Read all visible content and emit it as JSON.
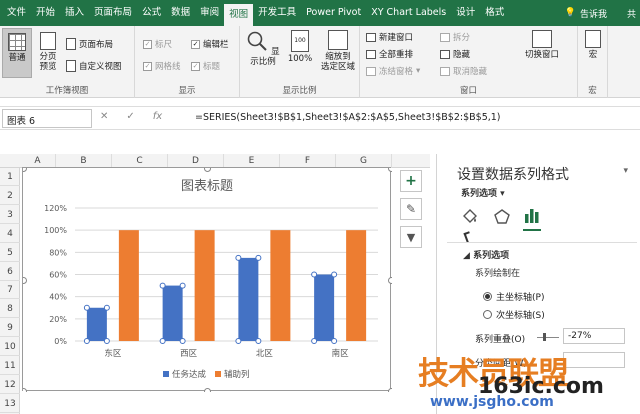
{
  "tabs": [
    "文件",
    "开始",
    "插入",
    "页面布局",
    "公式",
    "数据",
    "审阅",
    "视图",
    "开发工具",
    "Power Pivot",
    "XY Chart Labels",
    "设计",
    "格式"
  ],
  "active_tab": "视图",
  "tell_me": "告诉我",
  "share": "共",
  "ribbon": {
    "workbook_views": {
      "normal": "普通",
      "page_break": "分页\n预览",
      "page_layout": "页面布局",
      "custom_views": "自定义视图",
      "label": "工作簿视图"
    },
    "show": {
      "ruler": "标尺",
      "gridlines": "网格线",
      "formula_bar": "编辑栏",
      "headings": "标题",
      "label": "显示"
    },
    "zoom": {
      "zoom": "显示比例",
      "hundred": "100%",
      "zoom_selection": "缩放到\n选定区域",
      "label": "显示比例"
    },
    "window": {
      "new_window": "新建窗口",
      "arrange_all": "全部重排",
      "freeze": "冻结窗格",
      "split": "拆分",
      "hide": "隐藏",
      "unhide": "取消隐藏",
      "switch": "切换窗口",
      "label": "窗口"
    },
    "macros": {
      "macros": "宏",
      "label": "宏"
    }
  },
  "formula_bar": {
    "name_box": "图表 6",
    "cancel": "✕",
    "enter": "✓",
    "fx": "fx",
    "formula": "=SERIES(Sheet3!$B$1,Sheet3!$A$2:$A$5,Sheet3!$B$2:$B$5,1)"
  },
  "columns": [
    "A",
    "B",
    "C",
    "D",
    "E",
    "F",
    "G"
  ],
  "rows": [
    "1",
    "2",
    "3",
    "4",
    "5",
    "6",
    "7",
    "8",
    "9",
    "10",
    "11",
    "12",
    "13"
  ],
  "chart_data": {
    "type": "bar",
    "title": "图表标题",
    "categories": [
      "东区",
      "西区",
      "北区",
      "南区"
    ],
    "series": [
      {
        "name": "任务达成",
        "values": [
          0.3,
          0.5,
          0.75,
          0.6
        ],
        "color": "#4472c4"
      },
      {
        "name": "辅助列",
        "values": [
          1.0,
          1.0,
          1.0,
          1.0
        ],
        "color": "#ed7d31"
      }
    ],
    "ylim": [
      0,
      1.2
    ],
    "yticks": [
      "0%",
      "20%",
      "40%",
      "60%",
      "80%",
      "100%",
      "120%"
    ],
    "legend": "bottom",
    "grid": true
  },
  "side_buttons": {
    "add": "+",
    "brush": "✎",
    "filter": "▼"
  },
  "pane": {
    "title": "设置数据系列格式",
    "options_dropdown": "系列选项",
    "section": "系列选项",
    "plot_on": "系列绘制在",
    "primary_axis": "主坐标轴(P)",
    "secondary_axis": "次坐标轴(S)",
    "overlap_label": "系列重叠(O)",
    "overlap_value": "-27%",
    "gap_label": "分类间距(W)"
  },
  "watermark": {
    "main": "技术员联盟",
    "site": "163ic.com",
    "url": "www.jsgho.com"
  }
}
